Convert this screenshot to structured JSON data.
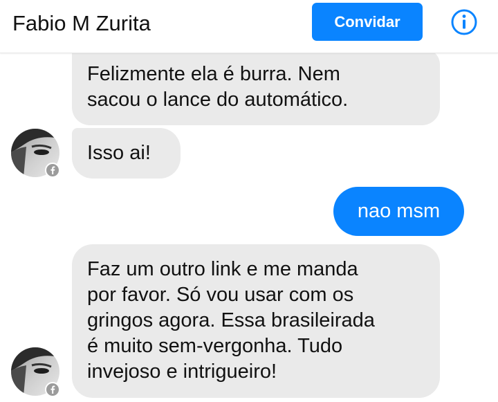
{
  "header": {
    "contact_name": "Fabio M Zurita",
    "invite_label": "Convidar",
    "info_icon": "info-circle-icon"
  },
  "colors": {
    "accent": "#0a84ff",
    "incoming_bubble": "#eaeaea",
    "outgoing_text": "#ffffff"
  },
  "messages": [
    {
      "direction": "incoming",
      "text": "Felizmente ela é burra. Nem\nsacou o lance do automático."
    },
    {
      "direction": "incoming",
      "text": "Isso ai!"
    },
    {
      "direction": "outgoing",
      "text": "nao msm"
    },
    {
      "direction": "incoming",
      "text": "Faz um outro link e me manda\npor favor. Só vou usar com os\ngringos agora. Essa brasileirada\né muito sem-vergonha. Tudo\ninvejoso e intrigueiro!"
    }
  ]
}
